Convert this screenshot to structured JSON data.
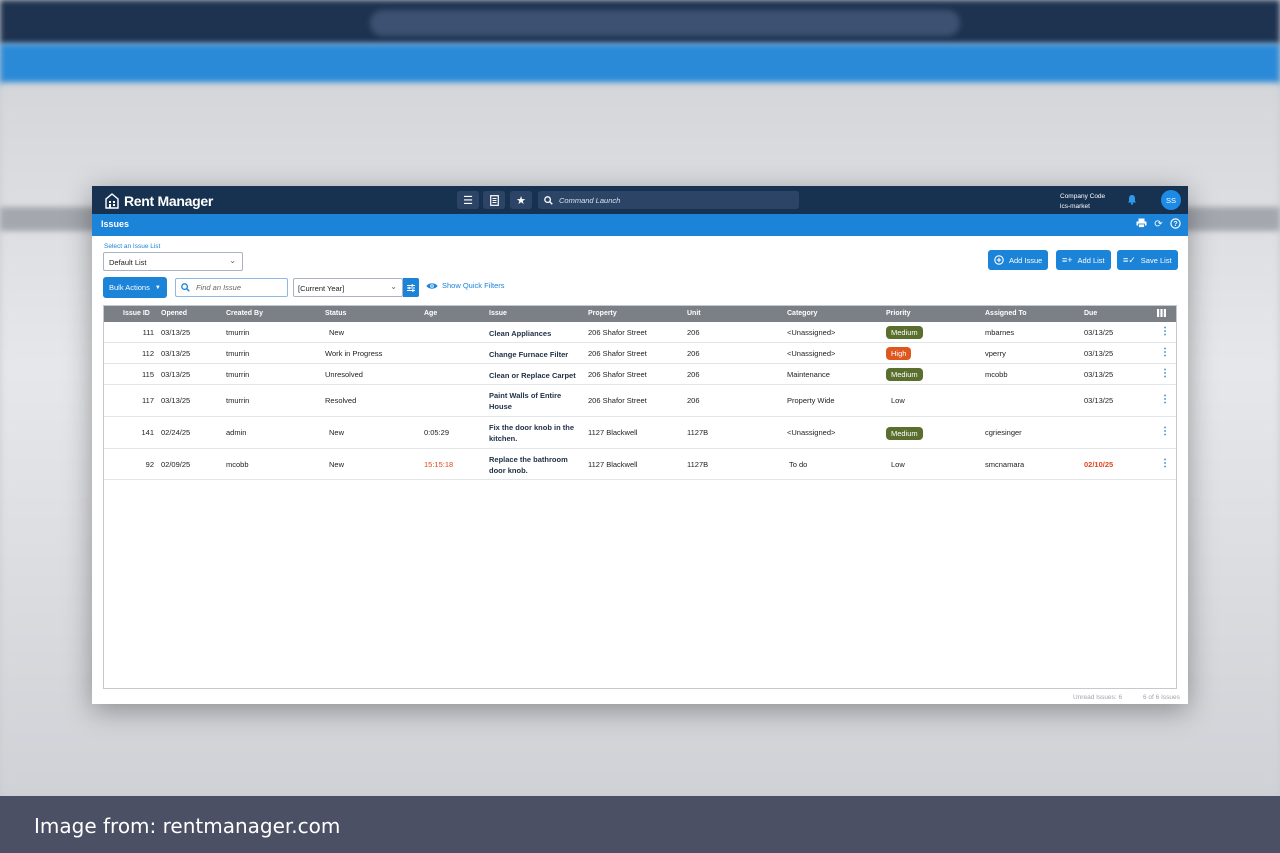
{
  "app": {
    "brand": "Rent Manager",
    "command_placeholder": "Command Launch",
    "company_label": "Company Code",
    "company_code": "lcs-market",
    "user_initials": "SS",
    "page_title": "Issues"
  },
  "controls": {
    "select_list_label": "Select an Issue List",
    "selected_list": "Default List",
    "add_issue": "Add Issue",
    "add_list": "Add List",
    "save_list": "Save List",
    "bulk_actions": "Bulk Actions",
    "find_placeholder": "Find an Issue",
    "year_filter": "[Current Year]",
    "quick_filters": "Show Quick Filters"
  },
  "table": {
    "columns": [
      "Issue ID",
      "Opened",
      "Created By",
      "Status",
      "Age",
      "Issue",
      "Property",
      "Unit",
      "Category",
      "Priority",
      "Assigned To",
      "Due"
    ],
    "rows": [
      {
        "id": "111",
        "opened": "03/13/25",
        "created_by": "tmurrin",
        "status": "New",
        "age": "",
        "issue": "Clean Appliances",
        "property": "206 Shafor Street",
        "unit": "206",
        "category": "<Unassigned>",
        "priority": "Medium",
        "assigned": "mbarnes",
        "due": "03/13/25"
      },
      {
        "id": "112",
        "opened": "03/13/25",
        "created_by": "tmurrin",
        "status": "Work in Progress",
        "age": "",
        "issue": "Change Furnace Filter",
        "property": "206 Shafor Street",
        "unit": "206",
        "category": "<Unassigned>",
        "priority": "High",
        "assigned": "vperry",
        "due": "03/13/25"
      },
      {
        "id": "115",
        "opened": "03/13/25",
        "created_by": "tmurrin",
        "status": "Unresolved",
        "age": "",
        "issue": "Clean or Replace Carpet",
        "property": "206 Shafor Street",
        "unit": "206",
        "category": "Maintenance",
        "priority": "Medium",
        "assigned": "mcobb",
        "due": "03/13/25"
      },
      {
        "id": "117",
        "opened": "03/13/25",
        "created_by": "tmurrin",
        "status": "Resolved",
        "age": "",
        "issue": "Paint Walls of Entire House",
        "property": "206 Shafor Street",
        "unit": "206",
        "category": "Property Wide",
        "priority": "Low",
        "assigned": "",
        "due": "03/13/25"
      },
      {
        "id": "141",
        "opened": "02/24/25",
        "created_by": "admin",
        "status": "New",
        "age": "0:05:29",
        "issue": "Fix the door knob in the kitchen.",
        "property": "1127 Blackwell",
        "unit": "1127B",
        "category": "<Unassigned>",
        "priority": "Medium",
        "assigned": "cgriesinger",
        "due": ""
      },
      {
        "id": "92",
        "opened": "02/09/25",
        "created_by": "mcobb",
        "status": "New",
        "age": "15:15:18",
        "issue": "Replace the bathroom door knob.",
        "property": "1127 Blackwell",
        "unit": "1127B",
        "category": "To do",
        "priority": "Low",
        "assigned": "smcnamara",
        "due": "02/10/25"
      }
    ]
  },
  "footer": {
    "unread": "Unread Issues: 6",
    "count": "6 of 6 Issues"
  },
  "caption": "Image from: rentmanager.com",
  "colors": {
    "accent": "#1b83d8",
    "navy": "#173251",
    "medium": "#5a6e2e",
    "high": "#e0561f",
    "overdue": "#e0461b"
  }
}
